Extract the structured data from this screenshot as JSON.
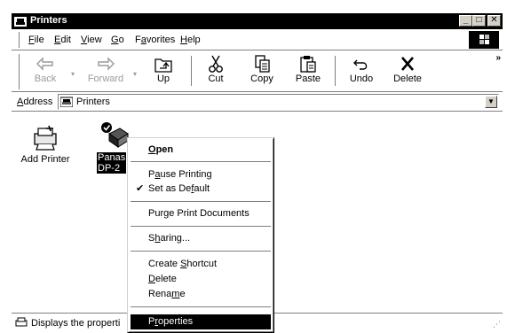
{
  "window": {
    "title": "Printers"
  },
  "title_buttons": {
    "minimize": "_",
    "maximize": "□",
    "close": "✕"
  },
  "menu": [
    {
      "pre": "",
      "key": "F",
      "post": "ile"
    },
    {
      "pre": "",
      "key": "E",
      "post": "dit"
    },
    {
      "pre": "",
      "key": "V",
      "post": "iew"
    },
    {
      "pre": "",
      "key": "G",
      "post": "o"
    },
    {
      "pre": "F",
      "key": "a",
      "post": "vorites"
    },
    {
      "pre": "",
      "key": "H",
      "post": "elp"
    }
  ],
  "toolbar": {
    "back": "Back",
    "forward": "Forward",
    "up": "Up",
    "cut": "Cut",
    "copy": "Copy",
    "paste": "Paste",
    "undo": "Undo",
    "delete": "Delete",
    "more": "»",
    "drop": "▾"
  },
  "address": {
    "label_pre": "A",
    "label_post": "ddress",
    "value": "Printers",
    "drop": "▼"
  },
  "items": [
    {
      "name": "Add Printer",
      "icon": "add-printer-icon"
    },
    {
      "name_line1": "Panas",
      "name_line2": "DP-2",
      "icon": "printer-default-icon",
      "selected": true
    }
  ],
  "status": {
    "text": "Displays the properti",
    "grip": "⋰"
  },
  "context_menu": {
    "open": {
      "pre": "",
      "key": "O",
      "post": "pen"
    },
    "pause": {
      "pre": "P",
      "key": "a",
      "post": "use Printing"
    },
    "default": {
      "pre": "Set as De",
      "key": "f",
      "post": "ault",
      "check": "✔"
    },
    "purge": {
      "pre": "Pur",
      "key": "g",
      "post": "e Print Documents"
    },
    "sharing": {
      "pre": "S",
      "key": "h",
      "post": "aring..."
    },
    "shortcut": {
      "pre": "Create ",
      "key": "S",
      "post": "hortcut"
    },
    "delete": {
      "pre": "",
      "key": "D",
      "post": "elete"
    },
    "rename": {
      "pre": "Rena",
      "key": "m",
      "post": "e"
    },
    "properties": {
      "pre": "P",
      "key": "r",
      "post": "operties"
    }
  }
}
